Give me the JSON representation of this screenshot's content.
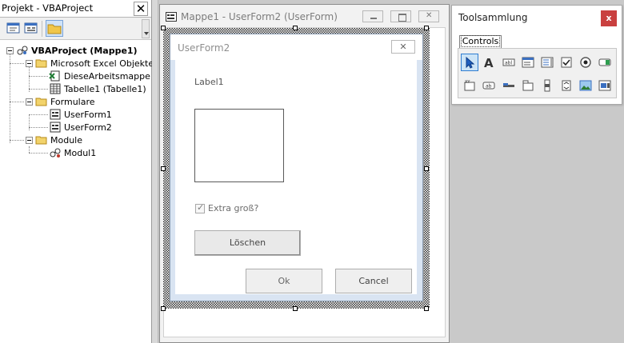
{
  "project": {
    "title": "Projekt - VBAProject",
    "close_glyph": "✕",
    "toolbar": [
      "view-code-icon",
      "view-object-icon",
      "toggle-folders-icon"
    ],
    "tree": {
      "root": "VBAProject (Mappe1)",
      "excel_folder": "Microsoft Excel Objekte",
      "workbook": "DieseArbeitsmappe",
      "sheet": "Tabelle1 (Tabelle1)",
      "forms_folder": "Formulare",
      "form1": "UserForm1",
      "form2": "UserForm2",
      "modules_folder": "Module",
      "module1": "Modul1"
    }
  },
  "designer": {
    "title": "Mappe1 - UserForm2 (UserForm)",
    "form": {
      "title": "UserForm2",
      "close_glyph": "✕",
      "label": "Label1",
      "checkbox": {
        "label": "Extra groß?",
        "checked": true
      },
      "clear_button": "Löschen",
      "ok_button": "Ok",
      "cancel_button": "Cancel"
    }
  },
  "toolbox": {
    "title": "Toolsammlung",
    "close_glyph": "x",
    "tab": "Controls",
    "tools": [
      "select-objects-icon",
      "label-icon",
      "textbox-icon",
      "combobox-icon",
      "listbox-icon",
      "checkbox-icon",
      "optionbutton-icon",
      "togglebutton-icon",
      "frame-icon",
      "commandbutton-icon",
      "tabstrip-icon",
      "multipage-icon",
      "scrollbar-icon",
      "spinbutton-icon",
      "image-icon",
      "refedit-icon"
    ],
    "colors": {
      "selected_bg": "#cce4f7",
      "selected_border": "#2f7dd1",
      "close_bg": "#c9403f"
    }
  }
}
